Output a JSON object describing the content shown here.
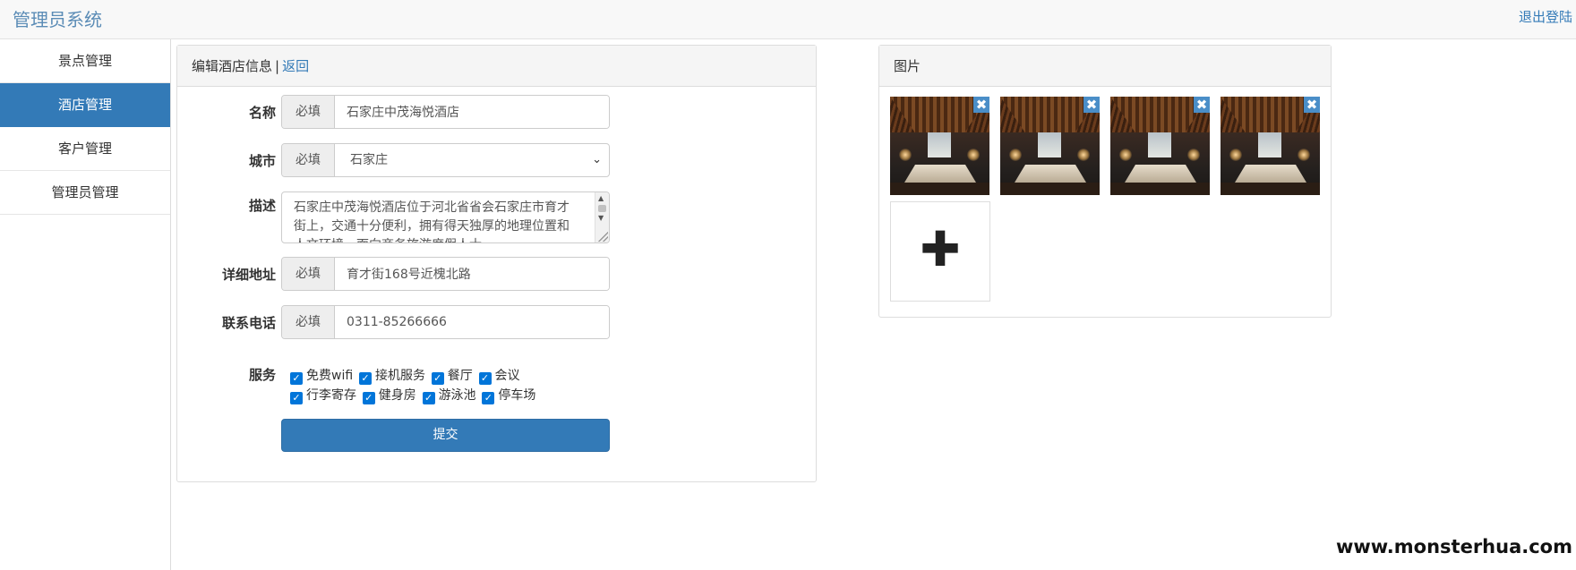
{
  "header": {
    "brand": "管理员系统",
    "logout_label": "退出登陆"
  },
  "sidebar": {
    "items": [
      {
        "label": "景点管理",
        "active": false
      },
      {
        "label": "酒店管理",
        "active": true
      },
      {
        "label": "客户管理",
        "active": false
      },
      {
        "label": "管理员管理",
        "active": false
      }
    ]
  },
  "edit_panel": {
    "title": "编辑酒店信息",
    "separator": "|",
    "back_label": "返回",
    "fields": {
      "name": {
        "label": "名称",
        "addon": "必填",
        "value": "石家庄中茂海悦酒店"
      },
      "city": {
        "label": "城市",
        "addon": "必填",
        "value": "石家庄"
      },
      "description": {
        "label": "描述",
        "value": "石家庄中茂海悦酒店位于河北省省会石家庄市育才街上，交通十分便利，拥有得天独厚的地理位置和人文环境，面向商务旅游度假人士"
      },
      "address": {
        "label": "详细地址",
        "addon": "必填",
        "value": "育才街168号近槐北路"
      },
      "phone": {
        "label": "联系电话",
        "addon": "必填",
        "value": "0311-85266666"
      }
    },
    "services": {
      "label": "服务",
      "rows": [
        [
          {
            "label": "免费wifi",
            "checked": true
          },
          {
            "label": "接机服务",
            "checked": true
          },
          {
            "label": "餐厅",
            "checked": true
          },
          {
            "label": "会议",
            "checked": true
          }
        ],
        [
          {
            "label": "行李寄存",
            "checked": true
          },
          {
            "label": "健身房",
            "checked": true
          },
          {
            "label": "游泳池",
            "checked": true
          },
          {
            "label": "停车场",
            "checked": true
          }
        ]
      ],
      "check_glyph": "✓"
    },
    "submit_label": "提交"
  },
  "image_panel": {
    "title": "图片",
    "images": [
      {
        "icon": "hotel-room-photo",
        "remove_glyph": "✖"
      },
      {
        "icon": "hotel-room-photo",
        "remove_glyph": "✖"
      },
      {
        "icon": "hotel-room-photo",
        "remove_glyph": "✖"
      },
      {
        "icon": "hotel-room-photo",
        "remove_glyph": "✖"
      }
    ],
    "add_glyph": "✚"
  },
  "watermark": "www.monsterhua.com",
  "colors": {
    "primary": "#337ab7",
    "brand_text": "#5b8cb6",
    "checkbox": "#0075d9"
  }
}
